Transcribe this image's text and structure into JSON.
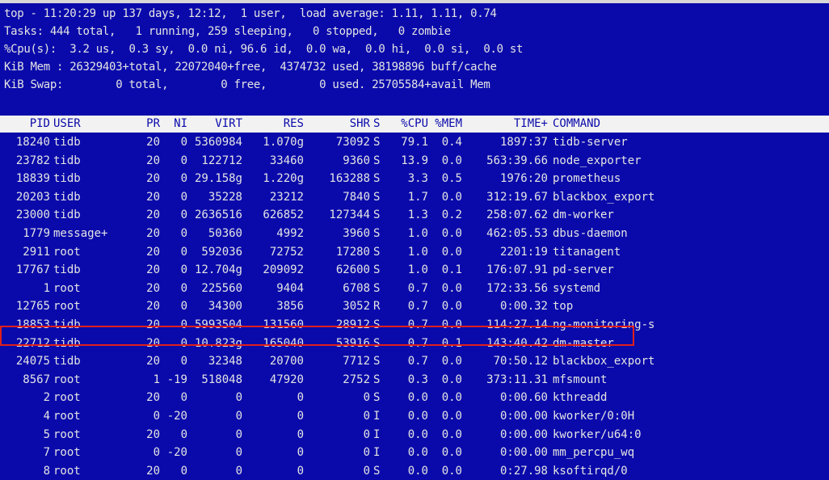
{
  "summary": [
    "top - 11:20:29 up 137 days, 12:12,  1 user,  load average: 1.11, 1.11, 0.74",
    "Tasks: 444 total,   1 running, 259 sleeping,   0 stopped,   0 zombie",
    "%Cpu(s):  3.2 us,  0.3 sy,  0.0 ni, 96.6 id,  0.0 wa,  0.0 hi,  0.0 si,  0.0 st",
    "KiB Mem : 26329403+total, 22072040+free,  4374732 used, 38198896 buff/cache",
    "KiB Swap:        0 total,        0 free,        0 used. 25705584+avail Mem"
  ],
  "header": {
    "pid": "PID",
    "user": "USER",
    "pr": "PR",
    "ni": "NI",
    "virt": "VIRT",
    "res": "RES",
    "shr": "SHR",
    "s": "S",
    "cpu": "%CPU",
    "mem": "%MEM",
    "time": "TIME+",
    "cmd": "COMMAND"
  },
  "processes": [
    {
      "pid": "18240",
      "user": "tidb",
      "pr": "20",
      "ni": "0",
      "virt": "5360984",
      "res": "1.070g",
      "shr": "73092",
      "s": "S",
      "cpu": "79.1",
      "mem": "0.4",
      "time": "1897:37",
      "cmd": "tidb-server"
    },
    {
      "pid": "23782",
      "user": "tidb",
      "pr": "20",
      "ni": "0",
      "virt": "122712",
      "res": "33460",
      "shr": "9360",
      "s": "S",
      "cpu": "13.9",
      "mem": "0.0",
      "time": "563:39.66",
      "cmd": "node_exporter"
    },
    {
      "pid": "18839",
      "user": "tidb",
      "pr": "20",
      "ni": "0",
      "virt": "29.158g",
      "res": "1.220g",
      "shr": "163288",
      "s": "S",
      "cpu": "3.3",
      "mem": "0.5",
      "time": "1976:20",
      "cmd": "prometheus"
    },
    {
      "pid": "20203",
      "user": "tidb",
      "pr": "20",
      "ni": "0",
      "virt": "35228",
      "res": "23212",
      "shr": "7840",
      "s": "S",
      "cpu": "1.7",
      "mem": "0.0",
      "time": "312:19.67",
      "cmd": "blackbox_export"
    },
    {
      "pid": "23000",
      "user": "tidb",
      "pr": "20",
      "ni": "0",
      "virt": "2636516",
      "res": "626852",
      "shr": "127344",
      "s": "S",
      "cpu": "1.3",
      "mem": "0.2",
      "time": "258:07.62",
      "cmd": "dm-worker"
    },
    {
      "pid": "1779",
      "user": "message+",
      "pr": "20",
      "ni": "0",
      "virt": "50360",
      "res": "4992",
      "shr": "3960",
      "s": "S",
      "cpu": "1.0",
      "mem": "0.0",
      "time": "462:05.53",
      "cmd": "dbus-daemon"
    },
    {
      "pid": "2911",
      "user": "root",
      "pr": "20",
      "ni": "0",
      "virt": "592036",
      "res": "72752",
      "shr": "17280",
      "s": "S",
      "cpu": "1.0",
      "mem": "0.0",
      "time": "2201:19",
      "cmd": "titanagent"
    },
    {
      "pid": "17767",
      "user": "tidb",
      "pr": "20",
      "ni": "0",
      "virt": "12.704g",
      "res": "209092",
      "shr": "62600",
      "s": "S",
      "cpu": "1.0",
      "mem": "0.1",
      "time": "176:07.91",
      "cmd": "pd-server"
    },
    {
      "pid": "1",
      "user": "root",
      "pr": "20",
      "ni": "0",
      "virt": "225560",
      "res": "9404",
      "shr": "6708",
      "s": "S",
      "cpu": "0.7",
      "mem": "0.0",
      "time": "172:33.56",
      "cmd": "systemd"
    },
    {
      "pid": "12765",
      "user": "root",
      "pr": "20",
      "ni": "0",
      "virt": "34300",
      "res": "3856",
      "shr": "3052",
      "s": "R",
      "cpu": "0.7",
      "mem": "0.0",
      "time": "0:00.32",
      "cmd": "top"
    },
    {
      "pid": "18853",
      "user": "tidb",
      "pr": "20",
      "ni": "0",
      "virt": "5993504",
      "res": "131560",
      "shr": "28912",
      "s": "S",
      "cpu": "0.7",
      "mem": "0.0",
      "time": "114:27.14",
      "cmd": "ng-monitoring-s"
    },
    {
      "pid": "22712",
      "user": "tidb",
      "pr": "20",
      "ni": "0",
      "virt": "10.823g",
      "res": "165040",
      "shr": "53916",
      "s": "S",
      "cpu": "0.7",
      "mem": "0.1",
      "time": "143:40.42",
      "cmd": "dm-master"
    },
    {
      "pid": "24075",
      "user": "tidb",
      "pr": "20",
      "ni": "0",
      "virt": "32348",
      "res": "20700",
      "shr": "7712",
      "s": "S",
      "cpu": "0.7",
      "mem": "0.0",
      "time": "70:50.12",
      "cmd": "blackbox_export"
    },
    {
      "pid": "8567",
      "user": "root",
      "pr": "1",
      "ni": "-19",
      "virt": "518048",
      "res": "47920",
      "shr": "2752",
      "s": "S",
      "cpu": "0.3",
      "mem": "0.0",
      "time": "373:11.31",
      "cmd": "mfsmount"
    },
    {
      "pid": "2",
      "user": "root",
      "pr": "20",
      "ni": "0",
      "virt": "0",
      "res": "0",
      "shr": "0",
      "s": "S",
      "cpu": "0.0",
      "mem": "0.0",
      "time": "0:00.60",
      "cmd": "kthreadd"
    },
    {
      "pid": "4",
      "user": "root",
      "pr": "0",
      "ni": "-20",
      "virt": "0",
      "res": "0",
      "shr": "0",
      "s": "I",
      "cpu": "0.0",
      "mem": "0.0",
      "time": "0:00.00",
      "cmd": "kworker/0:0H"
    },
    {
      "pid": "5",
      "user": "root",
      "pr": "20",
      "ni": "0",
      "virt": "0",
      "res": "0",
      "shr": "0",
      "s": "I",
      "cpu": "0.0",
      "mem": "0.0",
      "time": "0:00.00",
      "cmd": "kworker/u64:0"
    },
    {
      "pid": "7",
      "user": "root",
      "pr": "0",
      "ni": "-20",
      "virt": "0",
      "res": "0",
      "shr": "0",
      "s": "I",
      "cpu": "0.0",
      "mem": "0.0",
      "time": "0:00.00",
      "cmd": "mm_percpu_wq"
    },
    {
      "pid": "8",
      "user": "root",
      "pr": "20",
      "ni": "0",
      "virt": "0",
      "res": "0",
      "shr": "0",
      "s": "S",
      "cpu": "0.0",
      "mem": "0.0",
      "time": "0:27.98",
      "cmd": "ksoftirqd/0"
    }
  ],
  "colors": {
    "background": "#0a0aab",
    "text": "#e4e4e4",
    "header_bg": "#f2f2f2",
    "highlight": "#e0201a"
  }
}
